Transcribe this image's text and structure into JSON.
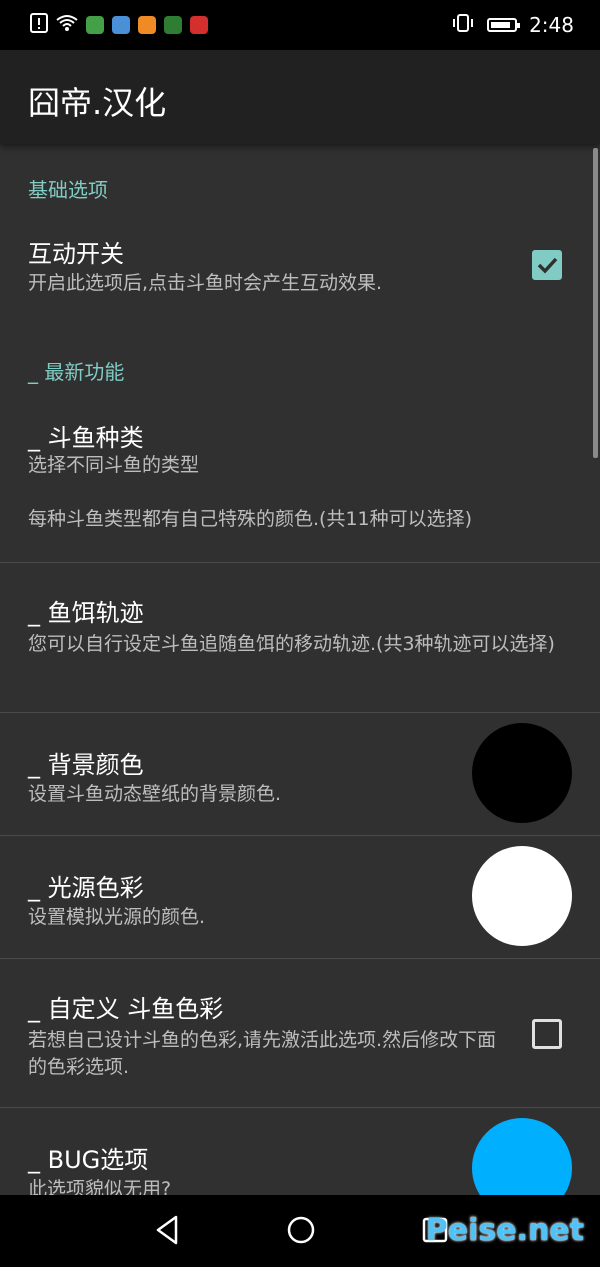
{
  "status_bar": {
    "time": "2:48",
    "battery_level": 0.85,
    "left_icons": [
      "alert-icon",
      "wifi-icon",
      "leaf-app-icon",
      "blue-app-icon",
      "orange-app-icon",
      "play-app-icon",
      "red-app-icon"
    ],
    "right_icons": [
      "vibrate-icon",
      "battery-icon"
    ]
  },
  "app_bar": {
    "title": "囧帝.汉化"
  },
  "sections": {
    "basic": {
      "header": "基础选项"
    },
    "newest": {
      "header": "_ 最新功能"
    }
  },
  "preferences": {
    "interaction": {
      "title": "互动开关",
      "summary": "开启此选项后,点击斗鱼时会产生互动效果.",
      "checked": true
    },
    "fish_type": {
      "title": "_ 斗鱼种类",
      "summary": "选择不同斗鱼的类型",
      "detail": "每种斗鱼类型都有自己特殊的颜色.(共11种可以选择)"
    },
    "bait_path": {
      "title": "_ 鱼饵轨迹",
      "summary": "您可以自行设定斗鱼追随鱼饵的移动轨迹.(共3种轨迹可以选择)"
    },
    "bg_color": {
      "title": "_ 背景颜色",
      "summary": "设置斗鱼动态壁纸的背景颜色.",
      "color": "#000000"
    },
    "light_color": {
      "title": "_ 光源色彩",
      "summary": "设置模拟光源的颜色.",
      "color": "#ffffff"
    },
    "custom_color": {
      "title": "_ 自定义 斗鱼色彩",
      "summary": "若想自己设计斗鱼的色彩,请先激活此选项.然后修改下面的色彩选项.",
      "checked": false
    },
    "bug": {
      "title": "_ BUG选项",
      "summary": "此选项貌似无用?",
      "color": "#00b0ff"
    }
  },
  "nav_bar": {
    "buttons": [
      "back-icon",
      "home-icon",
      "recents-icon"
    ]
  },
  "watermark": {
    "text": "Peise.net"
  },
  "colors": {
    "accent": "#80cbc4",
    "background": "#303030",
    "app_bar": "#212121"
  }
}
